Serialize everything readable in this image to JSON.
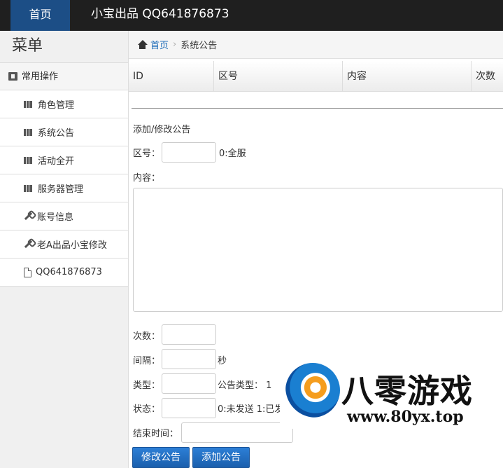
{
  "topbar": {
    "home": "首页",
    "brand": "小宝出品 QQ641876873"
  },
  "sidebar": {
    "title": "菜单",
    "group": "常用操作",
    "items": [
      {
        "label": "角色管理",
        "icon": "books-icon"
      },
      {
        "label": "系统公告",
        "icon": "books-icon"
      },
      {
        "label": "活动全开",
        "icon": "books-icon"
      },
      {
        "label": "服务器管理",
        "icon": "books-icon"
      },
      {
        "label": "账号信息",
        "icon": "wrench-icon"
      },
      {
        "label": "老A出品小宝修改",
        "icon": "wrench-icon"
      },
      {
        "label": "QQ641876873",
        "icon": "file-icon"
      }
    ]
  },
  "breadcrumb": {
    "home": "首页",
    "current": "系统公告"
  },
  "table": {
    "headers": [
      "ID",
      "区号",
      "内容",
      "次数"
    ]
  },
  "form": {
    "title": "添加/修改公告",
    "zone_label": "区号：",
    "zone_hint": "0:全服",
    "content_label": "内容：",
    "count_label": "次数：",
    "interval_label": "间隔：",
    "interval_unit": "秒",
    "type_label": "类型：",
    "type_hint": "公告类型： 1",
    "status_label": "状态：",
    "status_hint": "0:未发送 1:已发",
    "end_label": "结束时间：",
    "modify_button": "修改公告",
    "add_button": "添加公告"
  },
  "watermark": {
    "title": "八零游戏",
    "url": "www.80yx.top"
  },
  "colors": {
    "accent": "#1c4e86",
    "button": "#1f6ac2"
  }
}
